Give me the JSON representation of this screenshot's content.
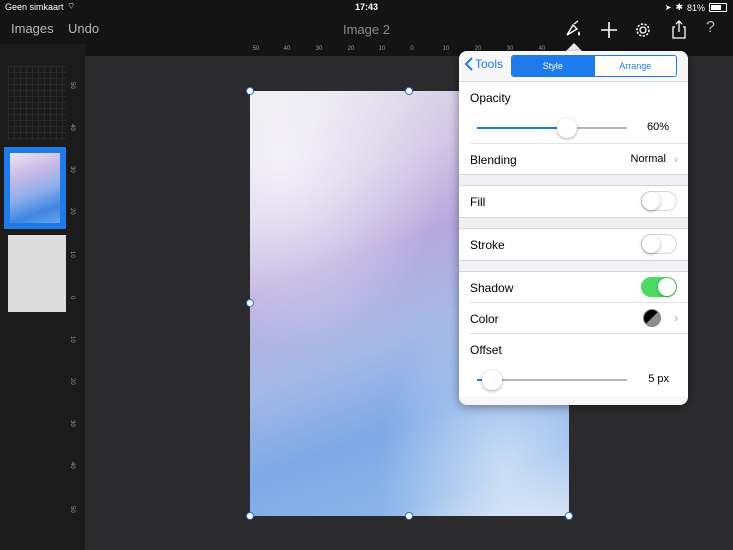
{
  "status": {
    "carrier": "Geen simkaart",
    "time": "17:43",
    "battery": "81%",
    "battery_level": 0.81
  },
  "toolbar": {
    "images_label": "Images",
    "undo_label": "Undo",
    "title": "Image 2",
    "icons": [
      "paint-brush-icon",
      "plus-icon",
      "gear-icon",
      "share-icon",
      "help-icon"
    ],
    "help_glyph": "?"
  },
  "ruler": {
    "top_ticks": [
      "50",
      "40",
      "30",
      "20",
      "10",
      "0",
      "10",
      "20",
      "30",
      "40"
    ],
    "left_ticks": [
      "50",
      "40",
      "30",
      "20",
      "10",
      "0",
      "10",
      "20",
      "30",
      "40",
      "50"
    ]
  },
  "popover": {
    "back_label": "Tools",
    "tabs": [
      {
        "label": "Style",
        "selected": true
      },
      {
        "label": "Arrange",
        "selected": false
      }
    ],
    "opacity": {
      "label": "Opacity",
      "value_text": "60%",
      "level": 0.6
    },
    "blending": {
      "label": "Blending",
      "value": "Normal"
    },
    "fill": {
      "label": "Fill",
      "on": false
    },
    "stroke": {
      "label": "Stroke",
      "on": false
    },
    "shadow": {
      "label": "Shadow",
      "on": true
    },
    "color": {
      "label": "Color"
    },
    "offset": {
      "label": "Offset",
      "value_text": "5 px",
      "level": 0.1
    }
  },
  "colors": {
    "accent": "#1f7bea",
    "toggle_on": "#4cd964",
    "toolbar_bg": "#141414",
    "workspace_bg": "#2b2b2d"
  }
}
